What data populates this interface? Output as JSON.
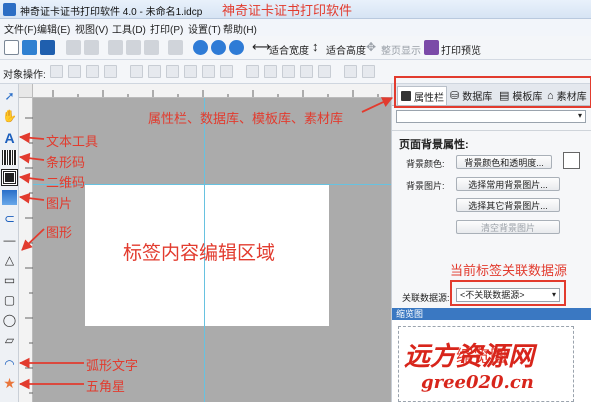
{
  "window": {
    "title": "神奇证卡证书打印软件 4.0 - 未命名1.idcp",
    "overlay_title": "神奇证卡证书打印软件"
  },
  "menu": [
    "文件(F)",
    "编辑(E)",
    "视图(V)",
    "工具(D)",
    "打印(P)",
    "设置(T)",
    "帮助(H)"
  ],
  "toolbar": {
    "fit_width": "适合宽度",
    "fit_height": "适合高度",
    "full_page": "整页显示",
    "print_preview": "打印预览"
  },
  "objbar": {
    "label": "对象操作:"
  },
  "right_panel": {
    "tabs": [
      "属性栏",
      "数据库",
      "模板库",
      "素材库"
    ],
    "section_title": "页面背景属性:",
    "bg_color_label": "背景颜色:",
    "bg_color_button": "背景颜色和透明度...",
    "bg_image_label": "背景图片:",
    "bg_image_common": "选择常用背景图片...",
    "bg_image_other": "选择其它背景图片...",
    "bg_image_clear": "清空背景图片",
    "datasource_label": "关联数据源:",
    "datasource_value": "<不关联数据源>",
    "thumbnail_title": "缩览图"
  },
  "annotations": {
    "panels": "属性栏、数据库、模板库、素材库",
    "text_tool": "文本工具",
    "barcode": "条形码",
    "qrcode": "二维码",
    "image": "图片",
    "shape": "图形",
    "canvas": "标签内容编辑区域",
    "datasource": "当前标签关联数据源",
    "arc_text": "弧形文字",
    "star": "五角星",
    "thumbnail": "缩览图"
  },
  "watermark": {
    "line1": "远方资源网",
    "line2": "gree020.cn"
  },
  "colors": {
    "annotation": "#e23b2e",
    "guide": "#67c2e0",
    "canvas_bg": "#ababab"
  }
}
